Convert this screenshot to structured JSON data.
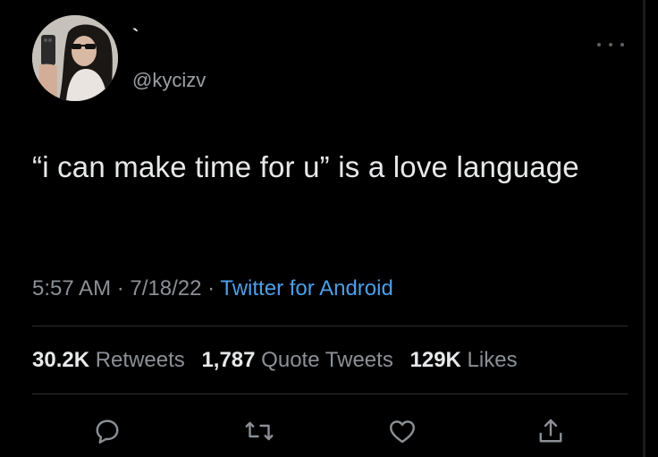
{
  "tweet": {
    "display_name": "`",
    "handle": "@kycizv",
    "text": "“i can make time for u” is a love language",
    "time": "5:57 AM",
    "date": "7/18/22",
    "source": "Twitter for Android",
    "separator": "·"
  },
  "stats": {
    "retweets_count": "30.2K",
    "retweets_label": "Retweets",
    "quotes_count": "1,787",
    "quotes_label": "Quote Tweets",
    "likes_count": "129K",
    "likes_label": "Likes"
  },
  "actions": [
    "reply-icon",
    "retweet-icon",
    "like-icon",
    "share-icon"
  ],
  "colors": {
    "background": "#000000",
    "text": "#e7e9ea",
    "secondary": "#8b9096",
    "link": "#4c9fe8"
  }
}
